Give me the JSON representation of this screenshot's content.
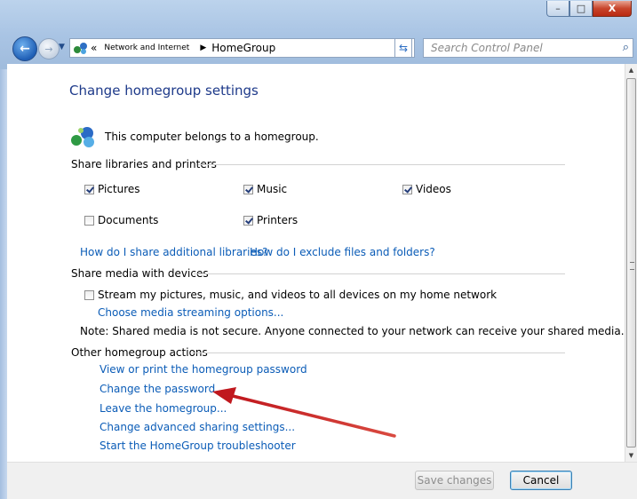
{
  "window": {
    "minimize": "–",
    "maximize": "□",
    "close": "X"
  },
  "address": {
    "overflow": "«",
    "crumbs": [
      "Network and Internet",
      "HomeGroup"
    ],
    "search_placeholder": "Search Control Panel"
  },
  "page": {
    "title": "Change homegroup settings",
    "belongs": "This computer belongs to a homegroup."
  },
  "libraries": {
    "header": "Share libraries and printers",
    "items": [
      {
        "label": "Pictures",
        "checked": true
      },
      {
        "label": "Music",
        "checked": true
      },
      {
        "label": "Videos",
        "checked": true
      },
      {
        "label": "Documents",
        "checked": false
      },
      {
        "label": "Printers",
        "checked": true
      }
    ],
    "link_share": "How do I share additional libraries?",
    "link_exclude": "How do I exclude files and folders?"
  },
  "media": {
    "header": "Share media with devices",
    "stream_label": "Stream my pictures, music, and videos to all devices on my home network",
    "stream_checked": false,
    "streaming_link": "Choose media streaming options...",
    "note": "Note: Shared media is not secure. Anyone connected to your network can receive your shared media."
  },
  "actions": {
    "header": "Other homegroup actions",
    "links": [
      "View or print the homegroup password",
      "Change the password...",
      "Leave the homegroup...",
      "Change advanced sharing settings...",
      "Start the HomeGroup troubleshooter"
    ]
  },
  "buttons": {
    "save": "Save changes",
    "cancel": "Cancel"
  },
  "annotation": {
    "arrow_color": "#c0181e"
  }
}
